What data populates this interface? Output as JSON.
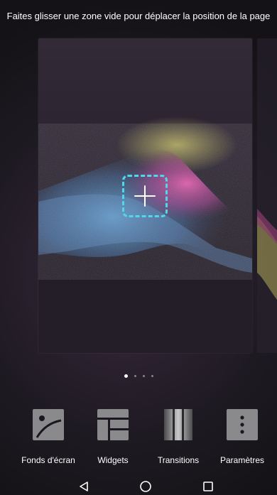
{
  "hint": {
    "text": "Faites glisser une zone vide pour déplacer la position de la page"
  },
  "preview": {
    "add_icon": "plus-icon"
  },
  "page_indicator": {
    "count": 4,
    "active_index": 0
  },
  "menu": {
    "items": [
      {
        "label": "Fonds d'écran",
        "icon": "wallpaper-icon"
      },
      {
        "label": "Widgets",
        "icon": "widgets-icon"
      },
      {
        "label": "Transitions",
        "icon": "transitions-icon"
      },
      {
        "label": "Paramètres",
        "icon": "settings-icon"
      }
    ]
  },
  "nav": {
    "back_icon": "back-triangle-icon",
    "home_icon": "home-circle-icon",
    "recents_icon": "recents-square-icon"
  },
  "colors": {
    "accent_dashed": "#4fd8e8",
    "icon_gray": "#8a8a8c",
    "text": "#ffffff"
  }
}
